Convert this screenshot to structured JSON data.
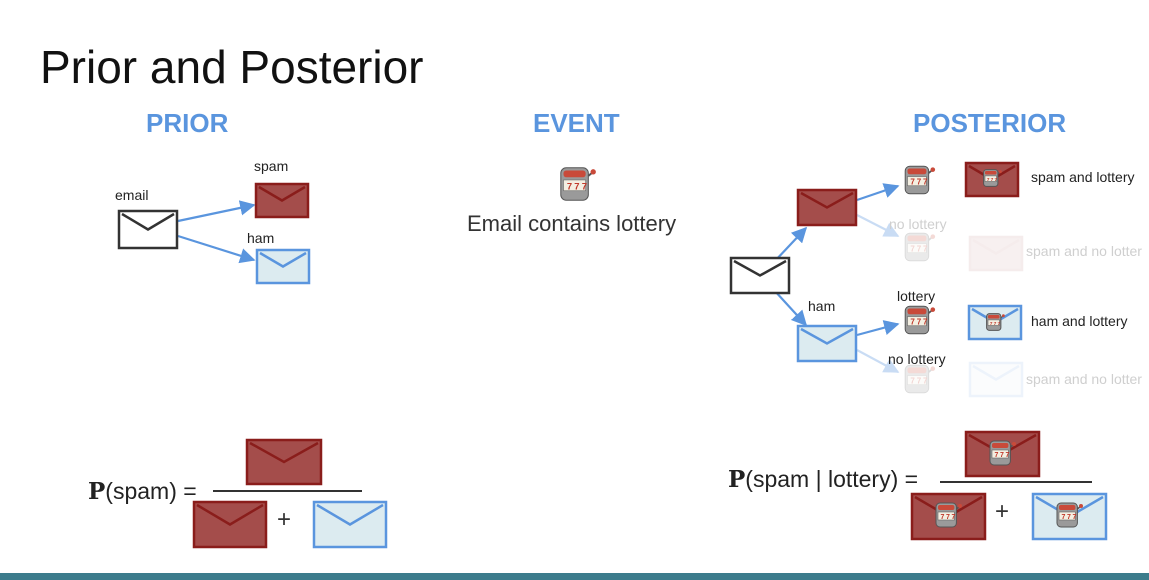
{
  "title": "Prior and Posterior",
  "sections": {
    "prior": "PRIOR",
    "event": "EVENT",
    "posterior": "POSTERIOR"
  },
  "prior": {
    "email_label": "email",
    "spam_label": "spam",
    "ham_label": "ham"
  },
  "event": {
    "text": "Email contains lottery"
  },
  "posterior": {
    "ham_label": "ham",
    "lottery_label": "lottery",
    "no_lottery_label_1": "no lottery",
    "no_lottery_label_2": "no lottery",
    "outcomes": [
      "spam and lottery",
      "spam and no lotter",
      "ham and lottery",
      "spam and no lotter"
    ]
  },
  "formulas": {
    "prior_P": "P",
    "prior_arg": "(spam) =",
    "posterior_P": "P",
    "posterior_arg": "(spam | lottery) =",
    "plus": "+"
  },
  "colors": {
    "spam_fill": "#a44d4b",
    "spam_stroke": "#8a1d1b",
    "ham_fill": "#dcebf0",
    "ham_stroke": "#5a95de",
    "email_stroke": "#333333",
    "arrow": "#5a95de",
    "accent": "#5a95de"
  },
  "icons": [
    "envelope-icon",
    "slot-machine-icon"
  ]
}
